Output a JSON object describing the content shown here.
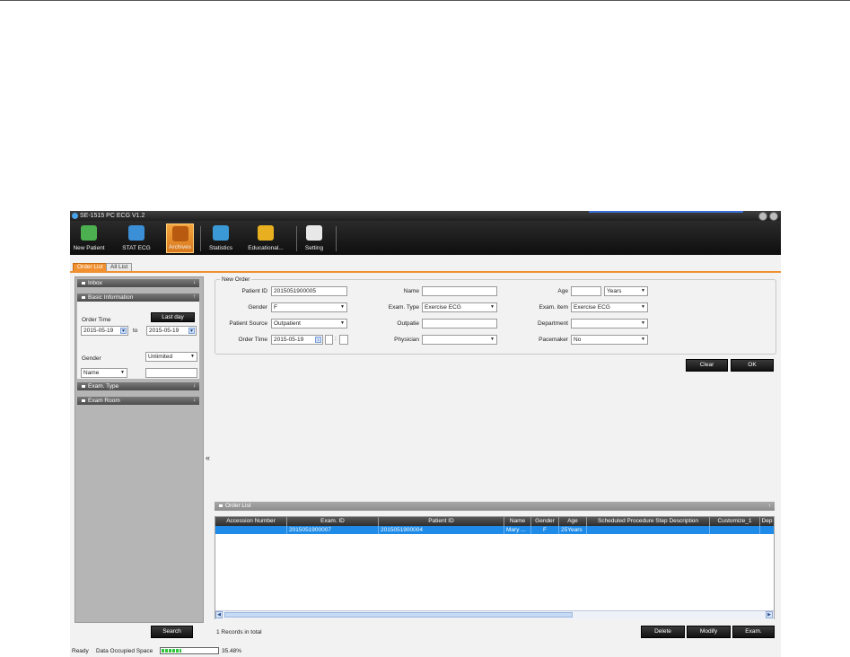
{
  "window": {
    "title": "SE-1515 PC ECG V1.2"
  },
  "toolbar": {
    "buttons": [
      {
        "label": "New Patient",
        "icon": "person-icon",
        "color": "#4caf50"
      },
      {
        "label": "STAT ECG",
        "icon": "heart-pulse-icon",
        "color": "#3b8fd6"
      },
      {
        "label": "Archives",
        "icon": "archive-icon",
        "color": "#e07a20",
        "active": true
      },
      {
        "label": "Statistics",
        "icon": "pie-chart-icon",
        "color": "#3b9ad6"
      },
      {
        "label": "Educational...",
        "icon": "book-icon",
        "color": "#e8b020"
      },
      {
        "label": "Setting",
        "icon": "gear-icon",
        "color": "#666666"
      }
    ]
  },
  "tabs": [
    "Order List",
    "All List"
  ],
  "sidebar": {
    "inbox": "Inbox",
    "basic_information": "Basic Information",
    "order_time_label": "Order Time",
    "last_day_button": "Last day",
    "date_from": "2015-05-19",
    "to_label": "to",
    "date_to": "2015-05-19",
    "gender_label": "Gender",
    "gender_value": "Unlimited",
    "name_select": "Name",
    "name_value": "",
    "exam_type": "Exam. Type",
    "exam_room": "Exam Room",
    "search_button": "Search"
  },
  "new_order": {
    "legend": "New Order",
    "patient_id_label": "Patient ID",
    "patient_id": "2015051900005",
    "name_label": "Name",
    "name": "",
    "age_label": "Age",
    "age": "",
    "age_unit": "Years",
    "gender_label": "Gender",
    "gender": "F",
    "exam_type_label": "Exam. Type",
    "exam_type": "Exercise ECG",
    "exam_item_label": "Exam. item",
    "exam_item": "Exercise ECG",
    "patient_source_label": "Patient Source",
    "patient_source": "Outpatient",
    "outpatie_label": "Outpatie",
    "outpatie": "",
    "department_label": "Department",
    "department": "",
    "order_time_label": "Order Time",
    "order_time": "2015-05-19",
    "order_time_sep": ":",
    "physician_label": "Physician",
    "physician": "",
    "pacemaker_label": "Pacemaker",
    "pacemaker": "No",
    "clear_button": "Clear",
    "ok_button": "OK"
  },
  "order_list": {
    "header": "Order List",
    "columns": [
      "Accession Number",
      "Exam. ID",
      "Patient ID",
      "Name",
      "Gender",
      "Age",
      "Scheduled Procedure Step Description",
      "Customize_1",
      "Dep"
    ],
    "rows": [
      [
        "",
        "2015051900007",
        "2015051900004",
        "Mary ...",
        "F",
        "25Years",
        "",
        "",
        ""
      ]
    ],
    "records": "1 Records in total",
    "delete_button": "Delete",
    "modify_button": "Modify",
    "exam_button": "Exam.",
    "selected_row_color": "#1e8be8"
  },
  "collapse_glyph": "«",
  "status": {
    "ready": "Ready",
    "space_label": "Data Occupied Space",
    "space_fraction": 0.3548,
    "space_percent": "35.48%"
  }
}
